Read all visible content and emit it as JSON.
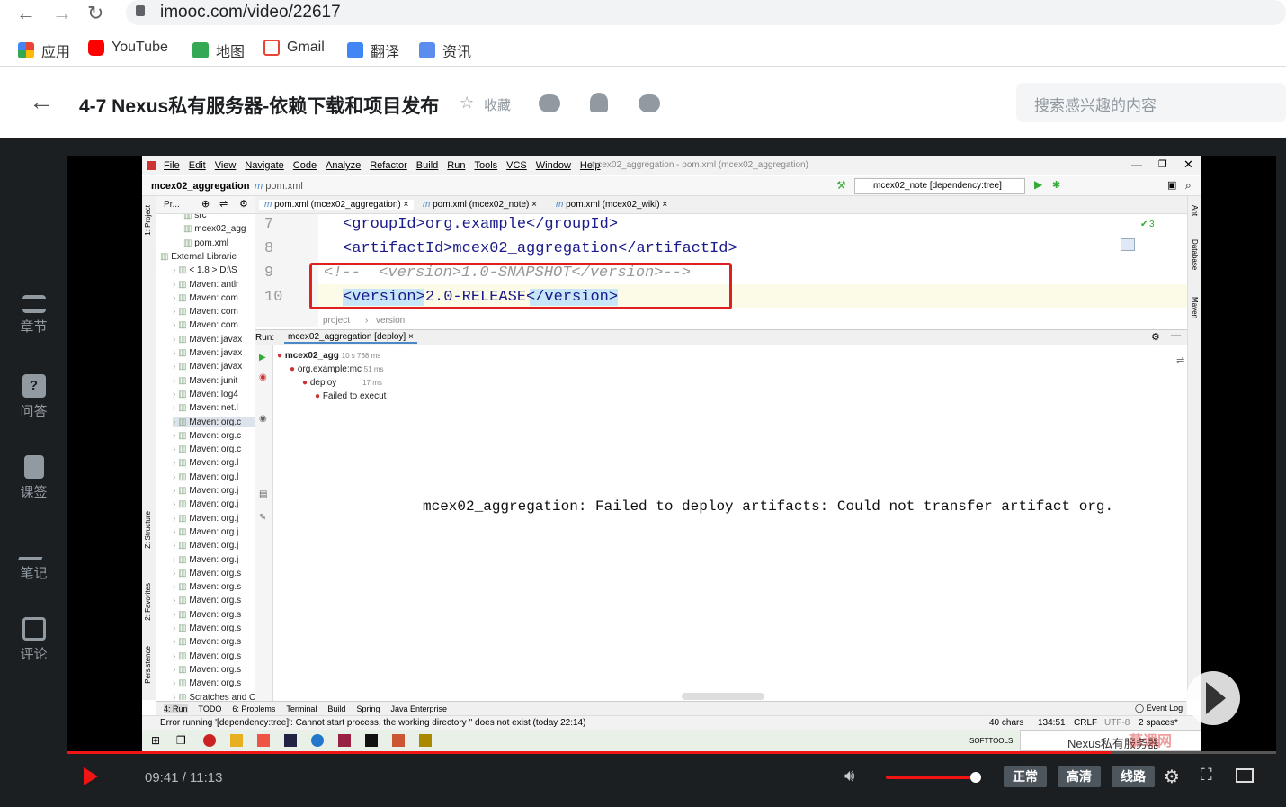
{
  "browser": {
    "url": "imooc.com/video/22617"
  },
  "bookmarks": [
    {
      "label": "应用",
      "color": "#4285f4"
    },
    {
      "label": "YouTube",
      "color": "#ff0000"
    },
    {
      "label": "地图",
      "color": "#34a853"
    },
    {
      "label": "Gmail",
      "color": "#ea4335"
    },
    {
      "label": "翻译",
      "color": "#4285f4"
    },
    {
      "label": "资讯",
      "color": "#4285f4"
    }
  ],
  "course": {
    "title": "4-7 Nexus私有服务器-依赖下载和项目发布",
    "collect": "收藏",
    "search_placeholder": "搜索感兴趣的内容"
  },
  "sidebar": [
    {
      "label": "章节"
    },
    {
      "label": "问答"
    },
    {
      "label": "课签"
    },
    {
      "label": "笔记"
    },
    {
      "label": "评论"
    }
  ],
  "ide": {
    "menu": [
      "File",
      "Edit",
      "View",
      "Navigate",
      "Code",
      "Analyze",
      "Refactor",
      "Build",
      "Run",
      "Tools",
      "VCS",
      "Window",
      "Help"
    ],
    "window_title": "mcex02_aggregation - pom.xml (mcex02_aggregation)",
    "breadcrumb_project": "mcex02_aggregation",
    "breadcrumb_file": "pom.xml",
    "run_config": "mcex02_note [dependency:tree]",
    "project_label": "Pr...",
    "tabs": [
      "pom.xml (mcex02_aggregation)",
      "pom.xml (mcex02_note)",
      "pom.xml (mcex02_wiki)"
    ],
    "tree": [
      "src",
      "mcex02_agg",
      "pom.xml",
      "External Librarie",
      "< 1.8 > D:\\S",
      "Maven: antlr",
      "Maven: com",
      "Maven: com",
      "Maven: com",
      "Maven: javax",
      "Maven: javax",
      "Maven: javax",
      "Maven: junit",
      "Maven: log4",
      "Maven: net.l",
      "Maven: org.c",
      "Maven: org.c",
      "Maven: org.c",
      "Maven: org.l",
      "Maven: org.l",
      "Maven: org.j",
      "Maven: org.j",
      "Maven: org.j",
      "Maven: org.j",
      "Maven: org.j",
      "Maven: org.j",
      "Maven: org.s",
      "Maven: org.s",
      "Maven: org.s",
      "Maven: org.s",
      "Maven: org.s",
      "Maven: org.s",
      "Maven: org.s",
      "Maven: org.s",
      "Maven: org.s",
      "Scratches and C"
    ],
    "code_lines": [
      {
        "num": "7",
        "text": "<groupId>org.example</groupId>"
      },
      {
        "num": "8",
        "text": "<artifactId>mcex02_aggregation</artifactId>"
      },
      {
        "num": "9",
        "text": "<!--  <version>1.0-SNAPSHOT</version>-->"
      },
      {
        "num": "10",
        "text": "<version>2.0-RELEASE</version>"
      }
    ],
    "inspection": "3",
    "editor_crumbs": [
      "project",
      "version"
    ],
    "run": {
      "label": "Run:",
      "tab": "mcex02_aggregation [deploy]",
      "root": "mcex02_agg",
      "root_time": "10 s 768 ms",
      "child": "org.example:mc",
      "child_time": "51 ms",
      "deploy": "deploy",
      "deploy_time": "17 ms",
      "failed": "Failed to execut",
      "console": "mcex02_aggregation: Failed to deploy artifacts: Could not transfer artifact org."
    },
    "bottom_tabs": [
      "4: Run",
      "TODO",
      "6: Problems",
      "Terminal",
      "Build",
      "Spring",
      "Java Enterprise"
    ],
    "event_log": "Event Log",
    "status_msg": "Error running '[dependency:tree]': Cannot start process, the working directory '' does not exist (today 22:14)",
    "status_right": [
      "40 chars",
      "134:51",
      "CRLF",
      "UTF-8",
      "2 spaces*"
    ],
    "left_strip": [
      "1: Project",
      "Z: Structure",
      "2: Favorites",
      "Persistence"
    ],
    "right_strip": [
      "Ant",
      "Database",
      "Maven"
    ]
  },
  "taskbar": {
    "softtools": "SOFTTOOLS",
    "nexus": "Nexus私有服务器",
    "watermark": "慕课网"
  },
  "player": {
    "time": "09:41 / 11:13",
    "quality": [
      "正常",
      "高清",
      "线路"
    ],
    "progress": 0.863
  }
}
